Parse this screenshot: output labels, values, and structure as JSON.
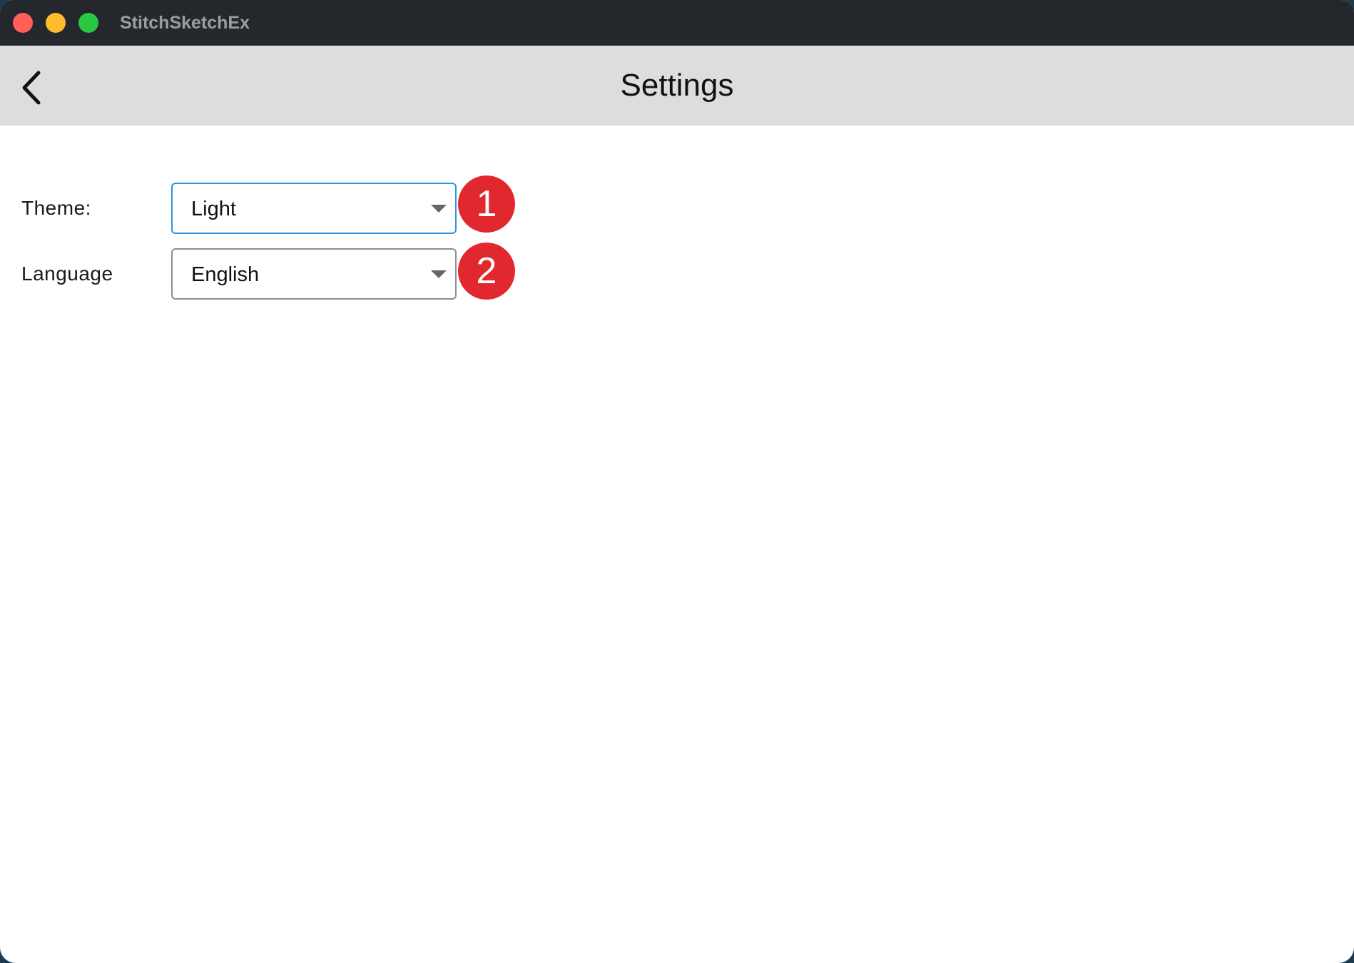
{
  "window": {
    "app_title": "StitchSketchEx",
    "buttons": {
      "close_color": "#ff5f57",
      "minimize_color": "#febc2e",
      "maximize_color": "#28c840"
    }
  },
  "appbar": {
    "back_icon": "chevron-left-icon",
    "title": "Settings"
  },
  "settings": {
    "theme": {
      "label": "Theme:",
      "selected": "Light",
      "badge": "1"
    },
    "language": {
      "label": "Language",
      "selected": "English",
      "badge": "2"
    }
  },
  "colors": {
    "focus_border": "#2d95e0",
    "badge_bg": "#e0282e",
    "appbar_bg": "#dddddd",
    "titlebar_bg": "#24282d"
  }
}
